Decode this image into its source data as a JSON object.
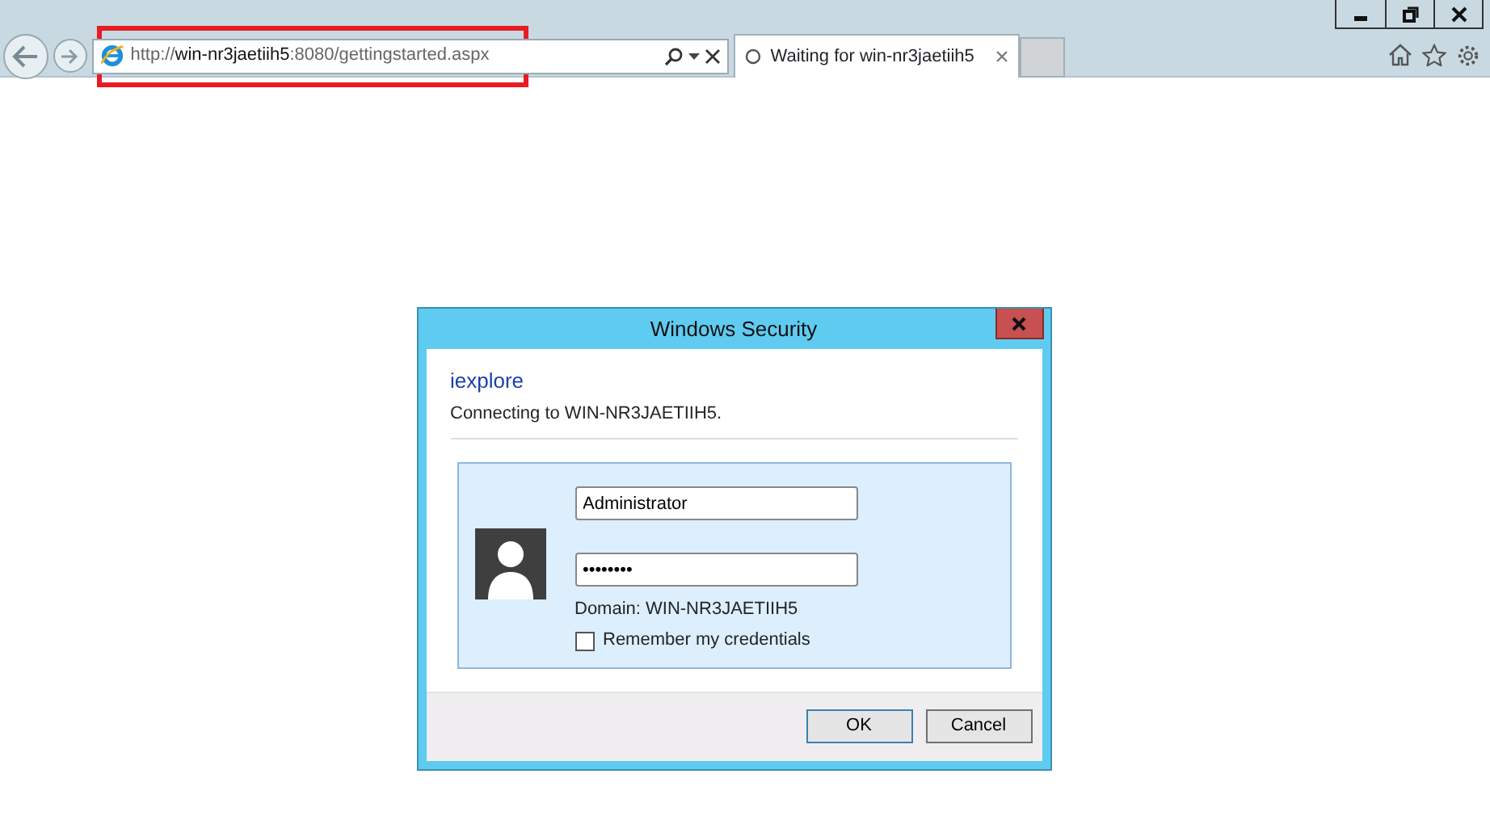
{
  "address_bar": {
    "url": "http://**win-nr3jaetiih5**:8080/gettingstarted.aspx",
    "highlighted": true
  },
  "tabs": [
    {
      "label": "Waiting for win-nr3jaetiih5",
      "loading": true,
      "selected": true
    }
  ],
  "dialog": {
    "title": "Windows Security",
    "app": "iexplore",
    "message": "Connecting to WIN-NR3JAETIIH5.",
    "username": "Administrator",
    "password": "••••••••",
    "domain": "Domain: WIN-NR3JAETIIH5",
    "remember": {
      "label": "Remember my credentials",
      "checked": false
    },
    "buttons": [
      "OK",
      "Cancel"
    ]
  }
}
